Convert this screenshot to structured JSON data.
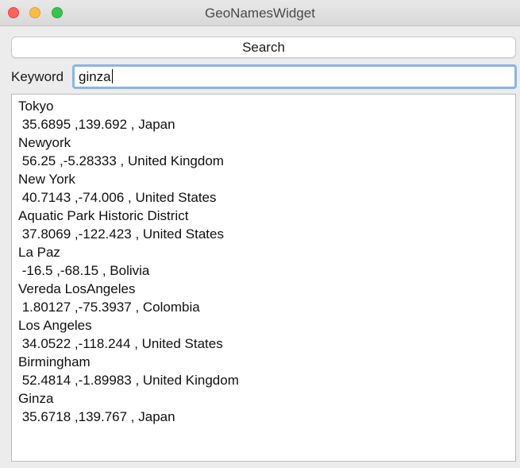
{
  "window": {
    "title": "GeoNamesWidget"
  },
  "toolbar": {
    "search_label": "Search"
  },
  "keyword": {
    "label": "Keyword",
    "value": "ginza"
  },
  "results": [
    {
      "name": "Tokyo",
      "detail": " 35.6895 ,139.692 , Japan"
    },
    {
      "name": "Newyork",
      "detail": " 56.25 ,-5.28333 , United Kingdom"
    },
    {
      "name": "New York",
      "detail": " 40.7143 ,-74.006 , United States"
    },
    {
      "name": "Aquatic Park Historic District",
      "detail": " 37.8069 ,-122.423 , United States"
    },
    {
      "name": "La Paz",
      "detail": " -16.5 ,-68.15 , Bolivia"
    },
    {
      "name": "Vereda LosAngeles",
      "detail": " 1.80127 ,-75.3937 , Colombia"
    },
    {
      "name": "Los Angeles",
      "detail": " 34.0522 ,-118.244 , United States"
    },
    {
      "name": "Birmingham",
      "detail": " 52.4814 ,-1.89983 , United Kingdom"
    },
    {
      "name": "Ginza",
      "detail": " 35.6718 ,139.767 , Japan"
    }
  ],
  "colors": {
    "close": "#fc615d",
    "minimize": "#fdbc40",
    "maximize": "#34c84a",
    "focus_ring": "#8ab4e8"
  }
}
